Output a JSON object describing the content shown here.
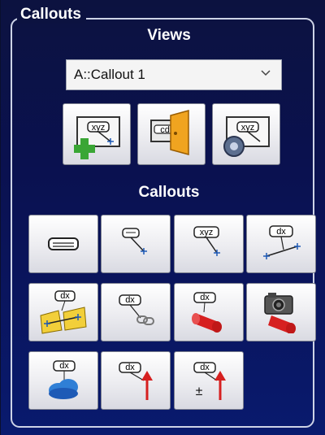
{
  "group": {
    "title": "Callouts"
  },
  "views": {
    "title": "Views",
    "select": {
      "value": "A::Callout 1"
    },
    "buttons": [
      {
        "icon": "add-view-icon",
        "label_text": "xyz"
      },
      {
        "icon": "switch-view-icon",
        "label_text": "cd"
      },
      {
        "icon": "view-settings-icon",
        "label_text": "xyz"
      }
    ]
  },
  "callouts": {
    "title": "Callouts",
    "buttons": [
      {
        "icon": "text-label-icon",
        "label_text": "text"
      },
      {
        "icon": "point-callout-icon",
        "label_text": ""
      },
      {
        "icon": "xyz-callout-icon",
        "label_text": "xyz"
      },
      {
        "icon": "distance-callout-icon",
        "label_text": "dx"
      },
      {
        "icon": "area-distance-callout-icon",
        "label_text": "dx"
      },
      {
        "icon": "chain-callout-icon",
        "label_text": "dx"
      },
      {
        "icon": "cylinder-callout-icon",
        "label_text": "dx"
      },
      {
        "icon": "camera-callout-icon",
        "label_text": ""
      },
      {
        "icon": "cloud-callout-icon",
        "label_text": "dx"
      },
      {
        "icon": "arrow-callout-icon",
        "label_text": "dx"
      },
      {
        "icon": "tolerance-callout-icon",
        "label_text": "dx",
        "symbol": "±"
      }
    ]
  },
  "colors": {
    "panel_bg": "#0a1150",
    "border": "#cdd3e6",
    "accent_green": "#3aa635",
    "accent_red": "#d62020",
    "accent_blue": "#1e5ab6"
  }
}
